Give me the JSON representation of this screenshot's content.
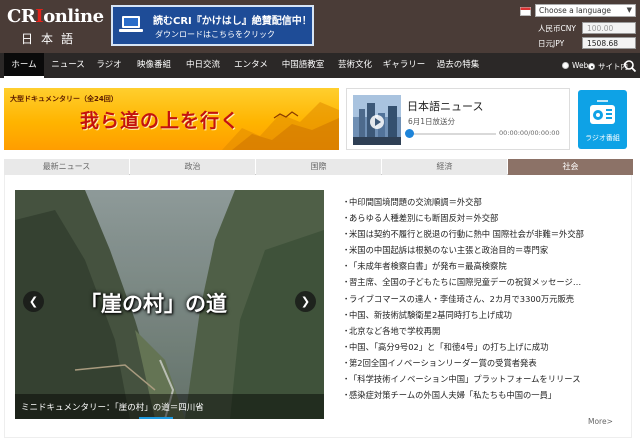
{
  "header": {
    "logo_main_prefix": "CR",
    "logo_main_i": "I",
    "logo_main_suffix": "online",
    "logo_sub": "日本語",
    "ad_line1": "読むCRI『かけはし』絶賛配信中！",
    "ad_line2": "ダウンロードはこちらをクリック",
    "language_select": "Choose a language",
    "rates": [
      {
        "label": "人民币CNY",
        "value": "100.00",
        "placeholder": true
      },
      {
        "label": "日元JPY",
        "value": "1508.68",
        "placeholder": false
      }
    ]
  },
  "nav": {
    "items": [
      "ホーム",
      "ニュース",
      "ラジオ",
      "映像番組",
      "中日交流",
      "エンタメ",
      "中国語教室",
      "芸術文化",
      "ギャラリー",
      "過去の特集"
    ],
    "active_index": 0,
    "search_options": [
      "Web",
      "サイト内"
    ],
    "search_selected": 1
  },
  "promo": {
    "small_label": "大型ドキュメンタリー（全24回）",
    "title": "我ら道の上を行く"
  },
  "player": {
    "title": "日本語ニュース",
    "date": "6月1日放送分",
    "time": "00:00:00/00:00:00",
    "progress": 0
  },
  "radio_app": {
    "label": "ラジオ番組"
  },
  "tabs": {
    "items": [
      "最新ニュース",
      "政治",
      "国際",
      "経済",
      "社会"
    ],
    "active_index": 4
  },
  "slideshow": {
    "title": "「崖の村」の道",
    "caption": "ミニドキュメンタリー：「崖の村」の道＝四川省",
    "prev_symbol": "❮",
    "next_symbol": "❯"
  },
  "news": {
    "bullet": "・",
    "items": [
      "中印間国境問題の交流順調＝外交部",
      "あらゆる人種差別にも断固反対＝外交部",
      "米国は契約不履行と脱退の行動に熱中 国際社会が非難＝外交部",
      "米国の中国起訴は根拠のない主張と政治目的＝専門家",
      "「未成年者検察白書」が発布＝最高検察院",
      "習主席、全国の子どもたちに国際児童デーの祝賀メッセージ…",
      "ライブコマースの達人・李佳琦さん、2カ月で3300万元販売",
      "中国、新技術試験衛星2基同時打ち上げ成功",
      "北京など各地で学校再開",
      "中国、「高分9号02」と「和徳4号」の打ち上げに成功",
      "第2回全国イノベーションリーダー賞の受賞者発表",
      "「科学技術イノベーション中国」プラットフォームをリリース",
      "感染症対策チームの外国人夫婦「私たちも中国の一員」"
    ],
    "more": "More>"
  },
  "colors": {
    "header_bg": "#4a3c37",
    "nav_bg": "#2b2827",
    "active_tab": "#8c7267",
    "promo_red": "#c4120e",
    "radio_blue": "#0ea2e6",
    "progress_blue": "#1e84d9"
  }
}
